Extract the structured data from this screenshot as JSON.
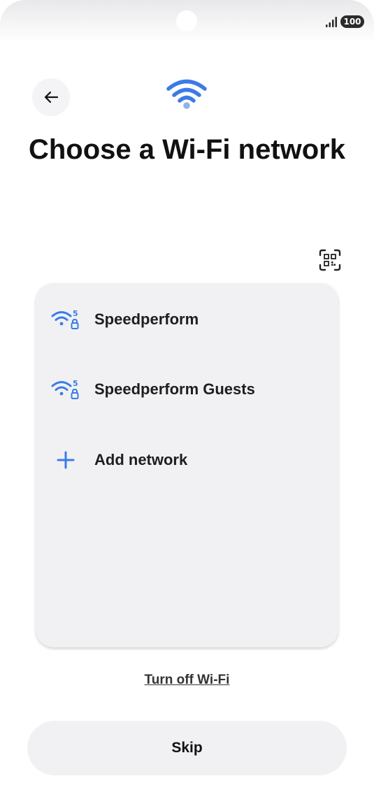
{
  "status_bar": {
    "battery_level": "100",
    "signal_icon": "signal-bars-icon"
  },
  "header": {
    "back_icon": "arrow-left-icon",
    "wifi_icon": "wifi-icon",
    "title": "Choose a Wi-Fi network",
    "qr_icon": "qr-code-scan-icon"
  },
  "networks": [
    {
      "name": "Speedperform",
      "icon": "wifi-5ghz-lock-icon"
    },
    {
      "name": "Speedperform Guests",
      "icon": "wifi-5ghz-lock-icon"
    }
  ],
  "add_network": {
    "label": "Add network",
    "icon": "plus-icon"
  },
  "turn_off_label": "Turn off Wi-Fi",
  "skip_label": "Skip",
  "colors": {
    "accent": "#3a7be6",
    "card": "#f1f1f4",
    "text": "#111111"
  }
}
